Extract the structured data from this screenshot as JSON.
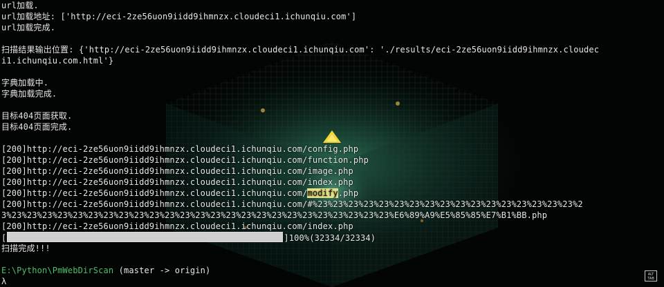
{
  "terminal": {
    "lines": [
      "url加载.",
      "url加载地址: ['http://eci-2ze56uon9iidd9ihmnzx.cloudeci1.ichunqiu.com']",
      "url加载完成.",
      "",
      "扫描结果输出位置: {'http://eci-2ze56uon9iidd9ihmnzx.cloudeci1.ichunqiu.com': './results/eci-2ze56uon9iidd9ihmnzx.cloudec",
      "i1.ichunqiu.com.html'}",
      "",
      "字典加载中.",
      "字典加载完成.",
      "",
      "目标404页面获取.",
      "目标404页面完成.",
      ""
    ],
    "results": [
      "[200]http://eci-2ze56uon9iidd9ihmnzx.cloudeci1.ichunqiu.com/config.php",
      "[200]http://eci-2ze56uon9iidd9ihmnzx.cloudeci1.ichunqiu.com/function.php",
      "[200]http://eci-2ze56uon9iidd9ihmnzx.cloudeci1.ichunqiu.com/image.php",
      "[200]http://eci-2ze56uon9iidd9ihmnzx.cloudeci1.ichunqiu.com/index.php"
    ],
    "modify_line": {
      "prefix": "[200]http://eci-2ze56uon9iidd9ihmnzx.cloudeci1.ichunqiu.com/",
      "highlight": "modify",
      "suffix": ".php"
    },
    "long_line_1": "[200]http://eci-2ze56uon9iidd9ihmnzx.cloudeci1.ichunqiu.com/#%23%23%23%23%23%23%23%23%23%23%23%23%23%23%23%23%23%2",
    "long_line_2": "3%23%23%23%23%23%23%23%23%23%23%23%23%23%23%23%23%23%23%23%23%23%23%23%23%23%E6%89%A9%E5%85%85%E7%B1%BB.php",
    "last_result": "[200]http://eci-2ze56uon9iidd9ihmnzx.cloudeci1.ichunqiu.com/index.php",
    "progress": {
      "open_bracket": "[",
      "close_and_text": "]100%(32334/32334)",
      "fraction": 1.0
    },
    "done": "扫描完成!!!",
    "prompt": {
      "path": "E:\\Python\\PmWebDirScan",
      "branch": " (master -> origin)",
      "symbol": "λ"
    },
    "corner_icon": "alt-tab-icon",
    "colors": {
      "path_green": "#4ec16a",
      "highlight": "#e8e28a",
      "text": "#e6e6e6"
    }
  }
}
